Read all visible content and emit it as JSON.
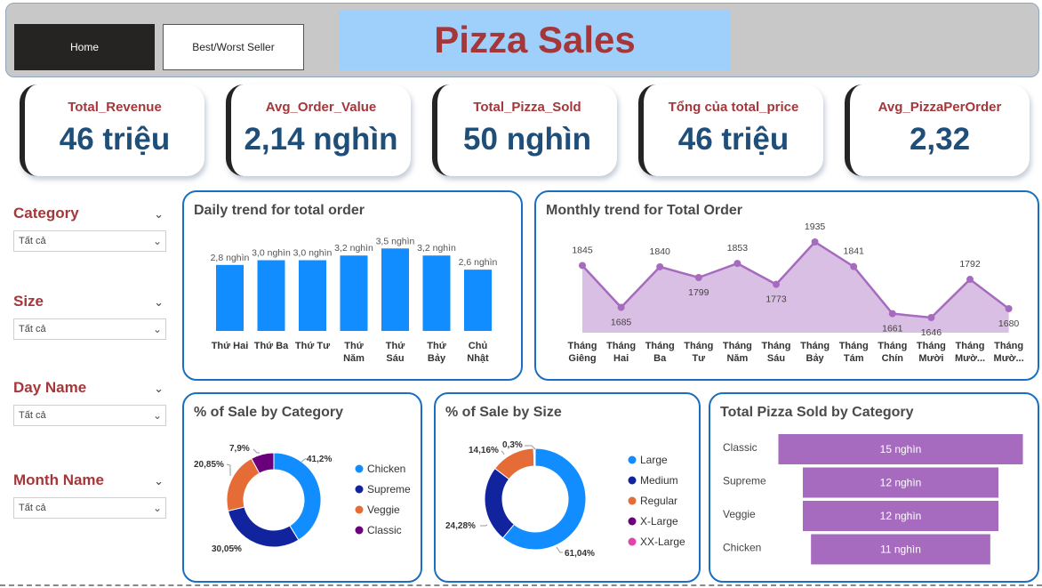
{
  "header": {
    "nav_home": "Home",
    "nav_best": "Best/Worst Seller",
    "title": "Pizza Sales"
  },
  "kpis": [
    {
      "label": "Total_Revenue",
      "value": "46 triệu"
    },
    {
      "label": "Avg_Order_Value",
      "value": "2,14 nghìn"
    },
    {
      "label": "Total_Pizza_Sold",
      "value": "50 nghìn"
    },
    {
      "label": "Tổng của total_price",
      "value": "46 triệu"
    },
    {
      "label": "Avg_PizzaPerOrder",
      "value": "2,32"
    }
  ],
  "slicers": [
    {
      "title": "Category",
      "value": "Tất cả"
    },
    {
      "title": "Size",
      "value": "Tất cả"
    },
    {
      "title": "Day Name",
      "value": "Tất cả"
    },
    {
      "title": "Month Name",
      "value": "Tất cả"
    }
  ],
  "colors": {
    "accent_title": "#a4373a",
    "kpi_value": "#1f4e79",
    "panel_border": "#1a6fc0",
    "bar_blue": "#118dff",
    "line_purple": "#a66bbe",
    "header_bg": "#c8c8c8",
    "title_bg": "#9fd0fb"
  },
  "icons": {
    "chevron": "chevron-down-icon"
  },
  "chart_data": [
    {
      "type": "bar",
      "title": "Daily trend for total order",
      "categories": [
        [
          "Thứ Hai"
        ],
        [
          "Thứ Ba"
        ],
        [
          "Thứ Tư"
        ],
        [
          "Thứ",
          "Năm"
        ],
        [
          "Thứ",
          "Sáu"
        ],
        [
          "Thứ",
          "Bảy"
        ],
        [
          "Chủ",
          "Nhật"
        ]
      ],
      "values": [
        2800,
        3000,
        3000,
        3200,
        3500,
        3200,
        2600
      ],
      "data_labels": [
        "2,8 nghìn",
        "3,0 nghìn",
        "3,0 nghìn",
        "3,2 nghìn",
        "3,5 nghìn",
        "3,2 nghìn",
        "2,6 nghìn"
      ],
      "ylim": [
        0,
        3700
      ],
      "color": "#118dff"
    },
    {
      "type": "area",
      "title": "Monthly trend for Total Order",
      "categories": [
        [
          "Tháng",
          "Giêng"
        ],
        [
          "Tháng",
          "Hai"
        ],
        [
          "Tháng",
          "Ba"
        ],
        [
          "Tháng",
          "Tư"
        ],
        [
          "Tháng",
          "Năm"
        ],
        [
          "Tháng",
          "Sáu"
        ],
        [
          "Tháng",
          "Bảy"
        ],
        [
          "Tháng",
          "Tám"
        ],
        [
          "Tháng",
          "Chín"
        ],
        [
          "Tháng",
          "Mười"
        ],
        [
          "Tháng",
          "Mườ..."
        ],
        [
          "Tháng",
          "Mườ..."
        ]
      ],
      "values": [
        1845,
        1685,
        1840,
        1799,
        1853,
        1773,
        1935,
        1841,
        1661,
        1646,
        1792,
        1680
      ],
      "ylim": [
        1600,
        1960
      ],
      "color": "#a66bbe"
    },
    {
      "type": "pie",
      "title": "% of Sale by Category",
      "labels": [
        "Chicken",
        "Supreme",
        "Veggie",
        "Classic"
      ],
      "values": [
        41.2,
        30.05,
        20.85,
        7.9
      ],
      "data_labels": [
        "41,2%",
        "30,05%",
        "20,85%",
        "7,9%"
      ],
      "colors": [
        "#118dff",
        "#12239e",
        "#e66c37",
        "#6b007b"
      ],
      "legend": "right"
    },
    {
      "type": "pie",
      "title": "% of Sale by Size",
      "labels": [
        "Large",
        "Medium",
        "Regular",
        "X-Large",
        "XX-Large"
      ],
      "values": [
        61.04,
        24.28,
        14.16,
        0.3,
        0.2
      ],
      "data_labels": [
        "61,04%",
        "24,28%",
        "14,16%",
        "0,3%",
        ""
      ],
      "colors": [
        "#118dff",
        "#12239e",
        "#e66c37",
        "#6b007b",
        "#e044a7"
      ],
      "legend": "right"
    },
    {
      "type": "bar",
      "orientation": "horizontal-funnel",
      "title": "Total Pizza Sold by Category",
      "categories": [
        "Classic",
        "Supreme",
        "Veggie",
        "Chicken"
      ],
      "values": [
        15000,
        12000,
        12000,
        11000
      ],
      "data_labels": [
        "15 nghìn",
        "12 nghìn",
        "12 nghìn",
        "11 nghìn"
      ],
      "color": "#a66bbe"
    }
  ]
}
